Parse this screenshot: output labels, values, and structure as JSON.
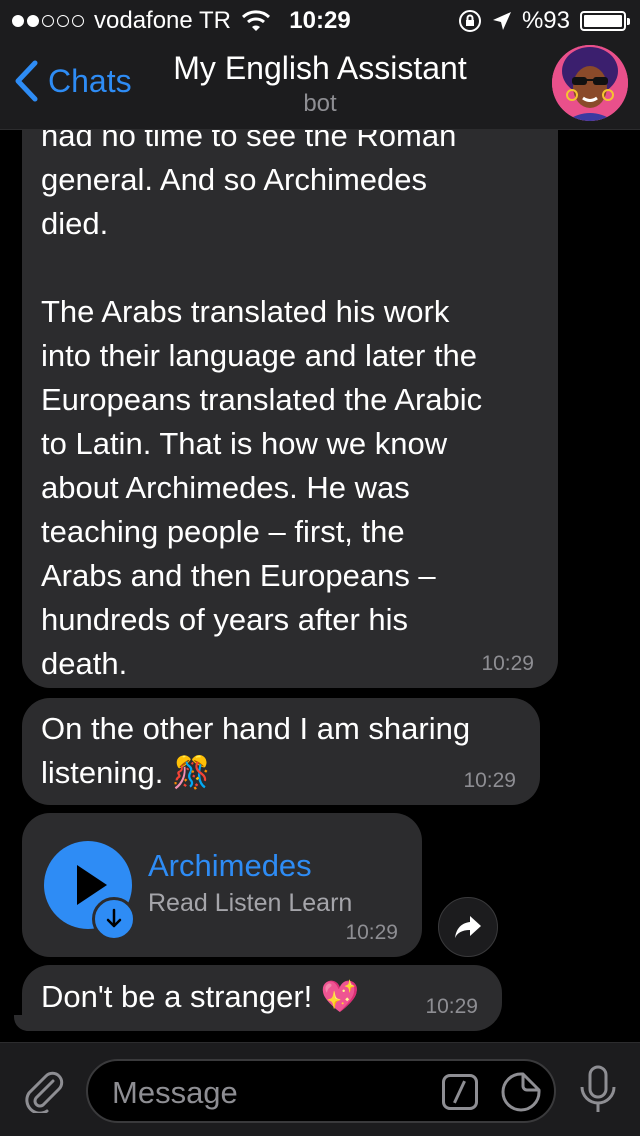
{
  "status_bar": {
    "carrier": "vodafone TR",
    "time": "10:29",
    "battery": "%93",
    "signal_dots_filled": 2,
    "signal_dots_total": 5,
    "battery_level": 0.93
  },
  "nav": {
    "back_label": "Chats",
    "title": "My English Assistant",
    "subtitle": "bot"
  },
  "messages": {
    "m1": {
      "lines": [
        "had no time to see the Roman",
        "general. And so Archimedes",
        "died.",
        "",
        "The Arabs translated his work",
        "into their language and later the",
        "Europeans translated the Arabic",
        "to Latin. That is how we know",
        "about Archimedes. He was",
        "teaching people – first, the",
        "Arabs and then Europeans –",
        "hundreds of years after his",
        "death."
      ],
      "time": "10:29"
    },
    "m2": {
      "line1": "On the other hand I am sharing",
      "line2": "listening.",
      "emoji": "🎊",
      "time": "10:29"
    },
    "m3": {
      "title": "Archimedes",
      "performer": "Read Listen Learn",
      "time": "10:29"
    },
    "m4": {
      "text": "Don't be a stranger!",
      "emoji": "💖",
      "time": "10:29"
    }
  },
  "input": {
    "placeholder": "Message"
  },
  "colors": {
    "accent": "#2e8cf5",
    "bubble": "#2c2c2e",
    "bar": "#1c1c1e",
    "background": "#000000",
    "secondary_text": "#8e8e93"
  },
  "icons": [
    "back-chevron-icon",
    "wifi-icon",
    "lock-rotation-icon",
    "location-arrow-icon",
    "battery-icon",
    "play-icon",
    "download-icon",
    "forward-icon",
    "paperclip-icon",
    "bot-command-icon",
    "sticker-icon",
    "microphone-icon"
  ]
}
